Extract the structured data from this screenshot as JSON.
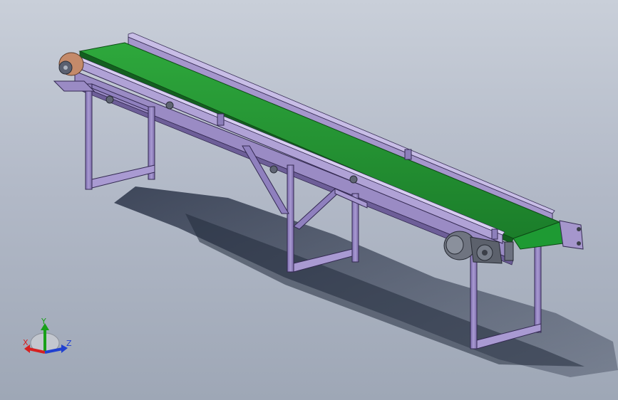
{
  "viewport": {
    "background_top": "#c9cfd9",
    "background_bottom": "#9ea7b6"
  },
  "model": {
    "belt_color": "#1f8a2e",
    "frame_color": "#8b7ab8",
    "pulley_color": "#c48a6a",
    "motor_color": "#6f7480"
  },
  "triad": {
    "x_label": "X",
    "y_label": "Y",
    "z_label": "Z",
    "x_color": "#d62020",
    "y_color": "#18a018",
    "z_color": "#2040d0"
  }
}
